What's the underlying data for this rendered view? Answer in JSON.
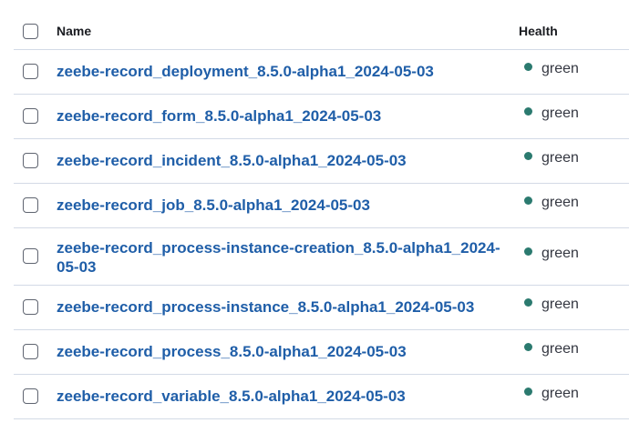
{
  "header": {
    "name_label": "Name",
    "health_label": "Health"
  },
  "status_color": "#2b7a6f",
  "rows": [
    {
      "name": "zeebe-record_deployment_8.5.0-alpha1_2024-05-03",
      "health": "green"
    },
    {
      "name": "zeebe-record_form_8.5.0-alpha1_2024-05-03",
      "health": "green"
    },
    {
      "name": "zeebe-record_incident_8.5.0-alpha1_2024-05-03",
      "health": "green"
    },
    {
      "name": "zeebe-record_job_8.5.0-alpha1_2024-05-03",
      "health": "green"
    },
    {
      "name": "zeebe-record_process-instance-creation_8.5.0-alpha1_2024-05-03",
      "health": "green"
    },
    {
      "name": "zeebe-record_process-instance_8.5.0-alpha1_2024-05-03",
      "health": "green"
    },
    {
      "name": "zeebe-record_process_8.5.0-alpha1_2024-05-03",
      "health": "green"
    },
    {
      "name": "zeebe-record_variable_8.5.0-alpha1_2024-05-03",
      "health": "green"
    }
  ]
}
